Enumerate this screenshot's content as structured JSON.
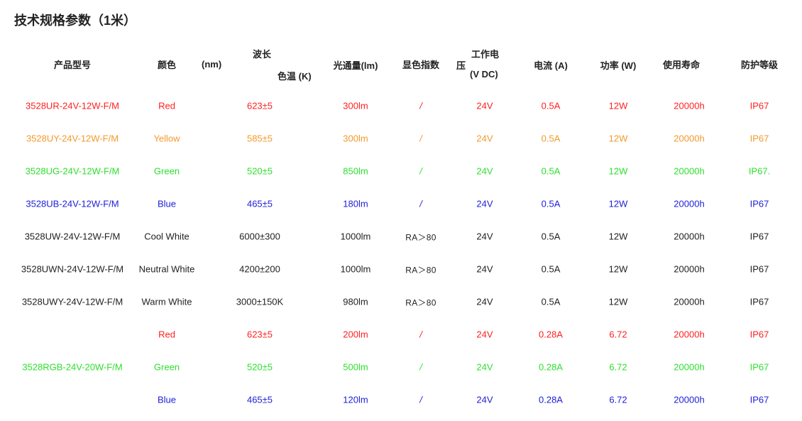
{
  "title": "技术规格参数（1米）",
  "headers": {
    "model": "产品型号",
    "color": "颜色",
    "nm": "(nm)",
    "wavelength": "波长",
    "cct": "色温 (K)",
    "flux": "光通量(lm)",
    "cri": "显色指数",
    "voltage_a": "工作电",
    "voltage_b": "压",
    "voltage_c": "(V DC)",
    "current": "电流 (A)",
    "power": "功率 (W)",
    "life": "使用寿命",
    "ip": "防护等级"
  },
  "colors": {
    "red": "#ff1f1f",
    "yellow": "#f39a2b",
    "green": "#2ee02e",
    "blue": "#2020d8",
    "text": "#222222"
  },
  "rows": [
    {
      "model": "3528UR-24V-12W-F/M",
      "color": "Red",
      "wl": "623±5",
      "flux": "300lm",
      "cri": "/",
      "voltage": "24V",
      "current": "0.5A",
      "power": "12W",
      "life": "20000h",
      "ip": "IP67",
      "tone": "red"
    },
    {
      "model": "3528UY-24V-12W-F/M",
      "color": "Yellow",
      "wl": "585±5",
      "flux": "300lm",
      "cri": "/",
      "voltage": "24V",
      "current": "0.5A",
      "power": "12W",
      "life": "20000h",
      "ip": "IP67",
      "tone": "yellow"
    },
    {
      "model": "3528UG-24V-12W-F/M",
      "color": "Green",
      "wl": "520±5",
      "flux": "850lm",
      "cri": "/",
      "voltage": "24V",
      "current": "0.5A",
      "power": "12W",
      "life": "20000h",
      "ip": "IP67.",
      "tone": "green"
    },
    {
      "model": "3528UB-24V-12W-F/M",
      "color": "Blue",
      "wl": "465±5",
      "flux": "180lm",
      "cri": "/",
      "voltage": "24V",
      "current": "0.5A",
      "power": "12W",
      "life": "20000h",
      "ip": "IP67",
      "tone": "blue"
    },
    {
      "model": "3528UW-24V-12W-F/M",
      "color": "Cool White",
      "wl": "6000±300",
      "flux": "1000lm",
      "cri": "RA＞80",
      "voltage": "24V",
      "current": "0.5A",
      "power": "12W",
      "life": "20000h",
      "ip": "IP67",
      "tone": "white"
    },
    {
      "model": "3528UWN-24V-12W-F/M",
      "color": "Neutral White",
      "wl": "4200±200",
      "flux": "1000lm",
      "cri": "RA＞80",
      "voltage": "24V",
      "current": "0.5A",
      "power": "12W",
      "life": "20000h",
      "ip": "IP67",
      "tone": "white"
    },
    {
      "model": "3528UWY-24V-12W-F/M",
      "color": "Warm White",
      "wl": "3000±150K",
      "flux": "980lm",
      "cri": "RA＞80",
      "voltage": "24V",
      "current": "0.5A",
      "power": "12W",
      "life": "20000h",
      "ip": "IP67",
      "tone": "white"
    },
    {
      "model": "",
      "color": "Red",
      "wl": "623±5",
      "flux": "200lm",
      "cri": "/",
      "voltage": "24V",
      "current": "0.28A",
      "power": "6.72",
      "life": "20000h",
      "ip": "IP67",
      "tone": "red"
    },
    {
      "model": "3528RGB-24V-20W-F/M",
      "color": "Green",
      "wl": "520±5",
      "flux": "500lm",
      "cri": "/",
      "voltage": "24V",
      "current": "0.28A",
      "power": "6.72",
      "life": "20000h",
      "ip": "IP67",
      "tone": "green"
    },
    {
      "model": "",
      "color": "Blue",
      "wl": "465±5",
      "flux": "120lm",
      "cri": "/",
      "voltage": "24V",
      "current": "0.28A",
      "power": "6.72",
      "life": "20000h",
      "ip": "IP67",
      "tone": "blue"
    }
  ]
}
